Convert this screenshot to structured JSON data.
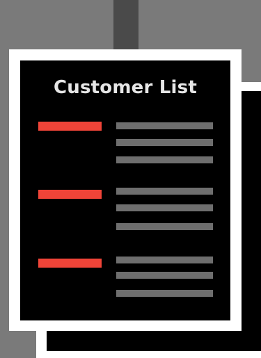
{
  "document": {
    "title": "Customer List"
  },
  "colors": {
    "background": "#7a7a7a",
    "stripe": "#4a4a4a",
    "sheet_border": "#ffffff",
    "sheet_fill": "#000000",
    "title_text": "#e6e6e6",
    "accent_bar": "#f04438",
    "detail_line": "#6e6e6e"
  },
  "entries_count": 3,
  "lines_per_entry": 3
}
